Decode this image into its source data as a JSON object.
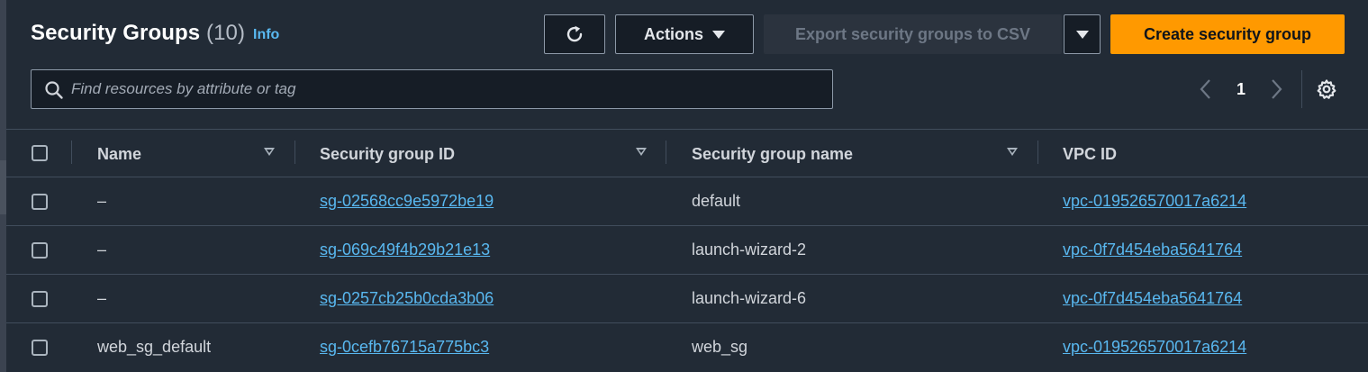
{
  "header": {
    "title": "Security Groups",
    "count": "(10)",
    "info_label": "Info"
  },
  "toolbar": {
    "refresh_icon": "refresh-icon",
    "actions_label": "Actions",
    "export_label": "Export security groups to CSV",
    "create_label": "Create security group"
  },
  "search": {
    "placeholder": "Find resources by attribute or tag",
    "value": ""
  },
  "pagination": {
    "current_page": "1"
  },
  "table": {
    "columns": [
      "Name",
      "Security group ID",
      "Security group name",
      "VPC ID"
    ],
    "rows": [
      {
        "name": "–",
        "sg_id": "sg-02568cc9e5972be19",
        "sg_name": "default",
        "vpc_id": "vpc-019526570017a6214"
      },
      {
        "name": "–",
        "sg_id": "sg-069c49f4b29b21e13",
        "sg_name": "launch-wizard-2",
        "vpc_id": "vpc-0f7d454eba5641764"
      },
      {
        "name": "–",
        "sg_id": "sg-0257cb25b0cda3b06",
        "sg_name": "launch-wizard-6",
        "vpc_id": "vpc-0f7d454eba5641764"
      },
      {
        "name": "web_sg_default",
        "sg_id": "sg-0cefb76715a775bc3",
        "sg_name": "web_sg",
        "vpc_id": "vpc-019526570017a6214"
      }
    ]
  },
  "colors": {
    "background": "#222b36",
    "accent": "#ff9900",
    "link": "#59b8f0"
  }
}
